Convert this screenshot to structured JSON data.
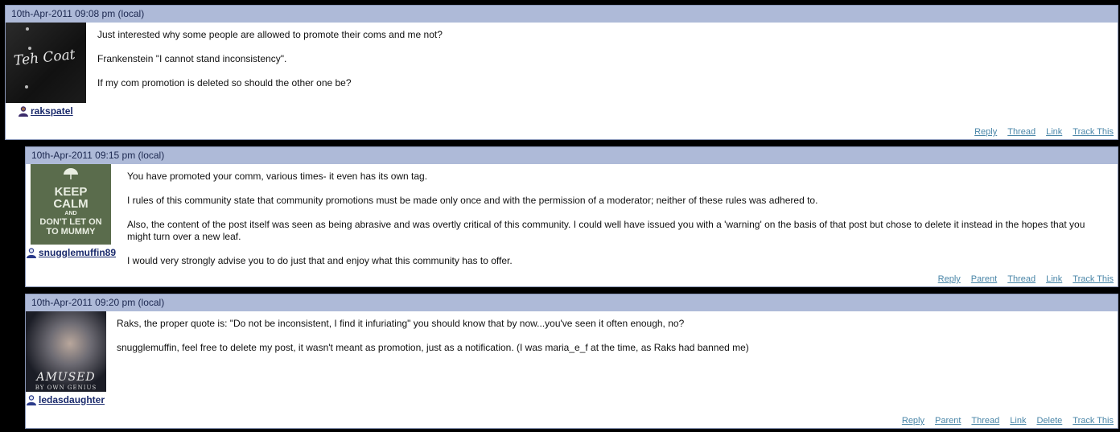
{
  "comments": [
    {
      "timestamp": "10th-Apr-2011 09:08 pm (local)",
      "username": "rakspatel",
      "avatar_text": "Teh Coat",
      "paragraphs": [
        "Just interested why some people are allowed to promote their coms and me not?",
        "Frankenstein \"I cannot stand inconsistency\".",
        "If my com promotion is deleted so should the other one be?"
      ],
      "actions": [
        "Reply",
        "Thread",
        "Link",
        "Track This"
      ]
    },
    {
      "timestamp": "10th-Apr-2011 09:15 pm (local)",
      "username": "snugglemuffin89",
      "avatar_text": [
        "KEEP",
        "CALM",
        "AND",
        "DON'T LET ON",
        "TO MUMMY"
      ],
      "paragraphs": [
        "You have promoted your comm, various times- it even has its own tag.",
        "I rules of this community state that community promotions must be made only once and with the permission of a moderator; neither of these rules was adhered to.",
        "Also, the content of the post itself was seen as being abrasive and was overtly critical of this community. I could well have issued you with a 'warning' on the basis of that post but chose to delete it instead in the hopes that you might turn over a new leaf.",
        "I would very strongly advise you to do just that and enjoy what this community has to offer."
      ],
      "actions": [
        "Reply",
        "Parent",
        "Thread",
        "Link",
        "Track This"
      ]
    },
    {
      "timestamp": "10th-Apr-2011 09:20 pm (local)",
      "username": "ledasdaughter",
      "avatar_text": [
        "AMUSED",
        "BY OWN GENIUS"
      ],
      "paragraphs": [
        "Raks, the proper quote is: \"Do not be inconsistent, I find it infuriating\" you should know that by now...you've seen it often enough, no?",
        "snugglemuffin, feel free to delete my post, it wasn't meant as promotion, just as a notification. (I was maria_e_f at the time, as Raks had banned me)"
      ],
      "actions": [
        "Reply",
        "Parent",
        "Thread",
        "Link",
        "Delete",
        "Track This"
      ]
    }
  ],
  "colors": {
    "header_bg": "#aebad8",
    "username": "#1a2a6c",
    "action_link": "#4a86a8"
  },
  "icons": [
    "user-icon"
  ]
}
